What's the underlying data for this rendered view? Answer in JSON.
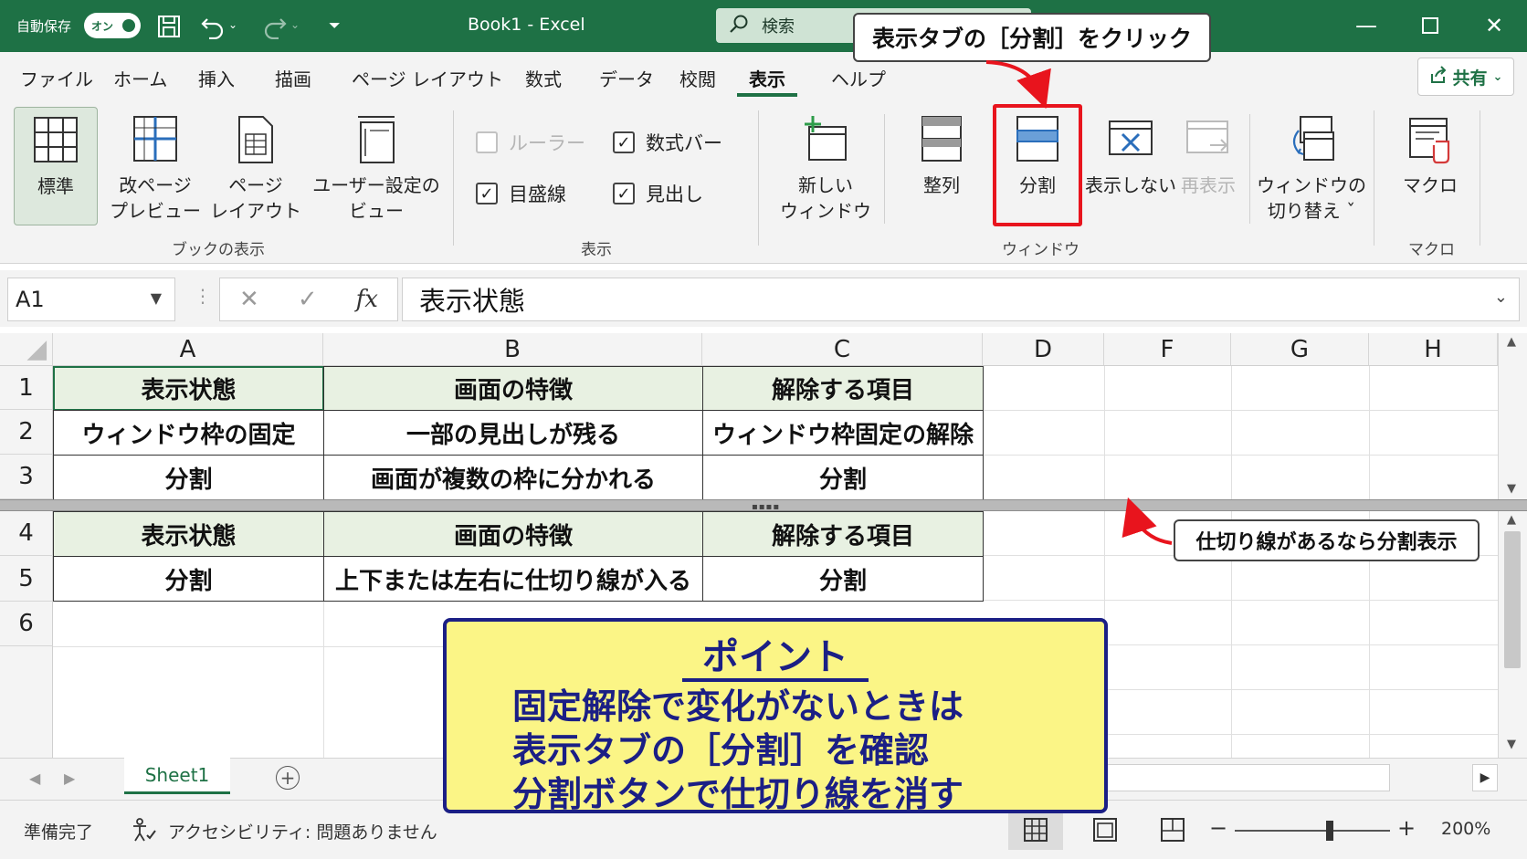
{
  "titlebar": {
    "autosave_label": "自動保存",
    "toggle_label": "オン",
    "doc_title": "Book1  -  Excel",
    "search_placeholder": "検索",
    "bg_color": "#1e7145"
  },
  "callouts": {
    "top": "表示タブの［分割］をクリック",
    "side": "仕切り線があるなら分割表示",
    "arrow_color": "#e8141d"
  },
  "tabs": [
    {
      "label": "ファイル"
    },
    {
      "label": "ホーム"
    },
    {
      "label": "挿入"
    },
    {
      "label": "描画"
    },
    {
      "label": "ページ レイアウト"
    },
    {
      "label": "数式"
    },
    {
      "label": "データ"
    },
    {
      "label": "校閲"
    },
    {
      "label": "表示"
    },
    {
      "label": "ヘルプ"
    }
  ],
  "active_tab": "表示",
  "share_label": "共有",
  "ribbon": {
    "book_view": {
      "normal": "標準",
      "page_break_1": "改ページ",
      "page_break_2": "プレビュー",
      "page_layout_1": "ページ",
      "page_layout_2": "レイアウト",
      "custom_1": "ユーザー設定の",
      "custom_2": "ビュー",
      "group": "ブックの表示"
    },
    "show": {
      "ruler": "ルーラー",
      "formula_bar": "数式バー",
      "gridlines": "目盛線",
      "headings": "見出し",
      "group": "表示"
    },
    "window": {
      "new_window_1": "新しい",
      "new_window_2": "ウィンドウ",
      "arrange": "整列",
      "split": "分割",
      "hide": "表示しない",
      "unhide": "再表示",
      "switch_1": "ウィンドウの",
      "switch_2": "切り替え ˇ",
      "group": "ウィンドウ"
    },
    "macro": {
      "macros": "マクロ",
      "group": "マクロ"
    }
  },
  "formula_bar": {
    "name_box": "A1",
    "fx": "fx",
    "content": "表示状態"
  },
  "columns": [
    "A",
    "B",
    "C",
    "D",
    "F",
    "G",
    "H"
  ],
  "rows": [
    "1",
    "2",
    "3",
    "4",
    "5",
    "6"
  ],
  "cells": {
    "r1": [
      "表示状態",
      "画面の特徴",
      "解除する項目"
    ],
    "r2": [
      "ウィンドウ枠の固定",
      "一部の見出しが残る",
      "ウィンドウ枠固定の解除"
    ],
    "r3": [
      "分割",
      "画面が複数の枠に分かれる",
      "分割"
    ],
    "r4": [
      "表示状態",
      "画面の特徴",
      "解除する項目"
    ],
    "r5": [
      "分割",
      "上下または左右に仕切り線が入る",
      "分割"
    ]
  },
  "point_box": {
    "title": "ポイント",
    "line1": "固定解除で変化がないときは",
    "line2": "表示タブの［分割］を確認",
    "line3": "分割ボタンで仕切り線を消す"
  },
  "sheet_tab": "Sheet1",
  "statusbar": {
    "ready": "準備完了",
    "accessibility": "アクセシビリティ: 問題ありません",
    "zoom": "200%"
  }
}
